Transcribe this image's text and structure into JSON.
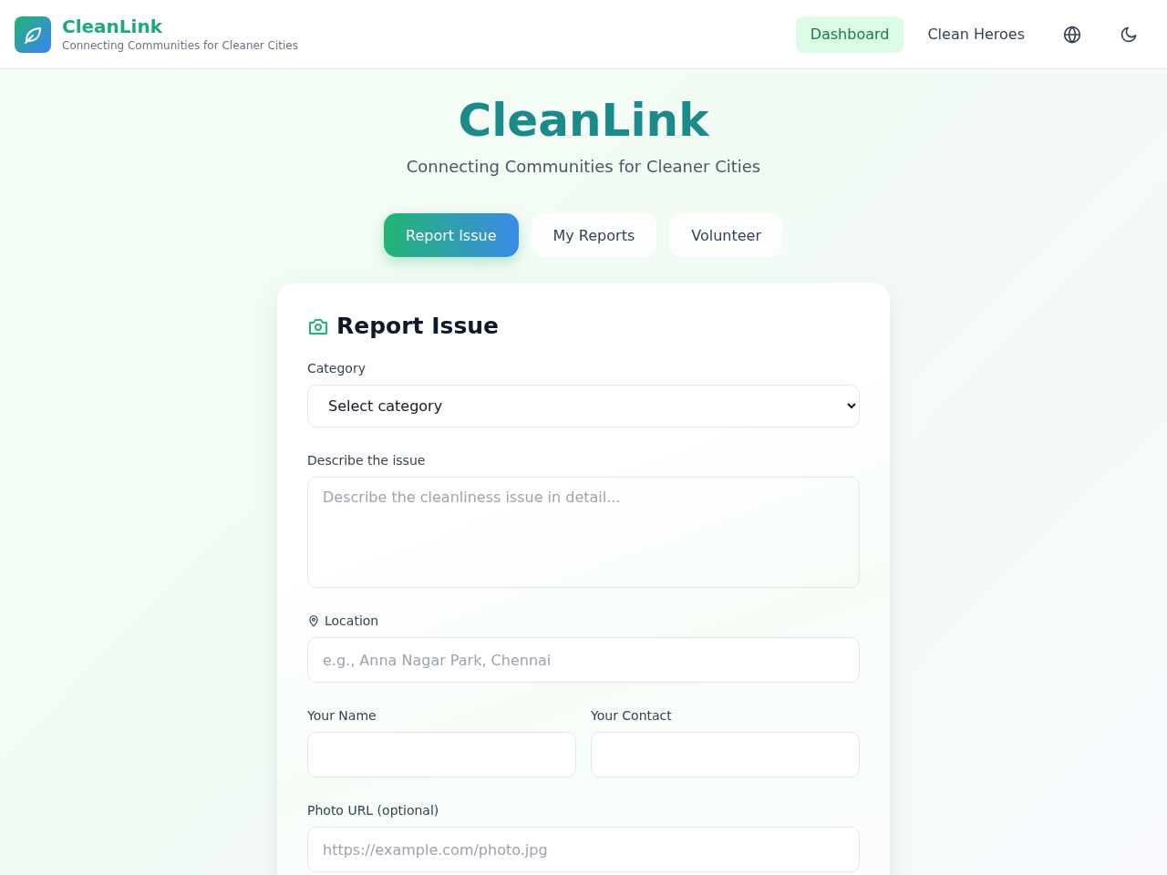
{
  "header": {
    "brand": "CleanLink",
    "tagline": "Connecting Communities for Cleaner Cities",
    "nav": [
      {
        "label": "Dashboard",
        "selected": true
      },
      {
        "label": "Clean Heroes",
        "selected": false
      }
    ]
  },
  "hero": {
    "title": "CleanLink",
    "subtitle": "Connecting Communities for Cleaner Cities"
  },
  "tabs": [
    {
      "label": "Report Issue",
      "selected": true
    },
    {
      "label": "My Reports",
      "selected": false
    },
    {
      "label": "Volunteer",
      "selected": false
    }
  ],
  "form": {
    "title": "Report Issue",
    "fields": [
      {
        "kind": "select",
        "label": "Category",
        "value": "Select category"
      },
      {
        "kind": "textarea",
        "label": "Describe the issue",
        "placeholder": "Describe the cleanliness issue in detail..."
      },
      {
        "kind": "location",
        "label": "Location",
        "placeholder": "e.g., Anna Nagar Park, Chennai"
      },
      {
        "kind": "pair",
        "items": [
          {
            "label": "Your Name"
          },
          {
            "label": "Your Contact"
          }
        ]
      },
      {
        "kind": "text",
        "label": "Photo URL (optional)",
        "placeholder": "https://example.com/photo.jpg"
      }
    ]
  }
}
